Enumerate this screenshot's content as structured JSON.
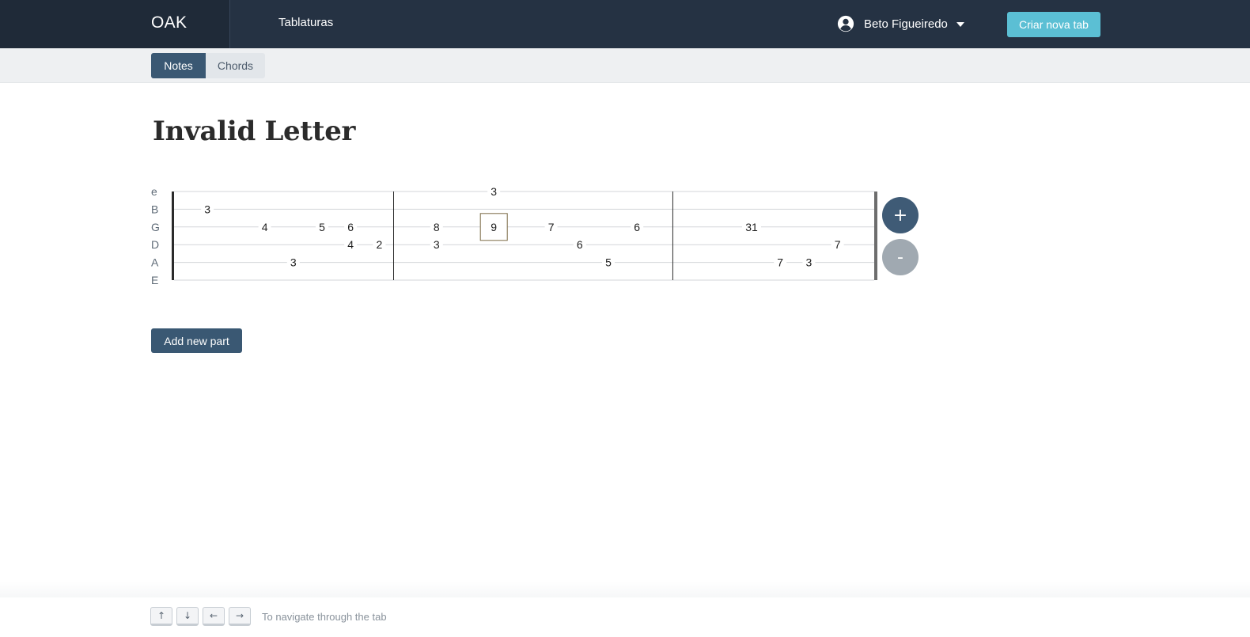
{
  "navbar": {
    "brand": "OAK",
    "nav_link": "Tablaturas",
    "user_name": "Beto Figueiredo",
    "cta_label": "Criar nova tab",
    "user_icon": "user-circle-icon",
    "caret_icon": "caret-down-icon"
  },
  "tabs": [
    {
      "label": "Notes",
      "active": true
    },
    {
      "label": "Chords",
      "active": false
    }
  ],
  "title": "Invalid Letter",
  "tablature": {
    "strings": [
      "e",
      "B",
      "G",
      "D",
      "A",
      "E"
    ],
    "notes": [
      {
        "string": 1,
        "col": 1,
        "fret": "3"
      },
      {
        "string": 2,
        "col": 3,
        "fret": "4"
      },
      {
        "string": 4,
        "col": 4,
        "fret": "3"
      },
      {
        "string": 2,
        "col": 5,
        "fret": "5"
      },
      {
        "string": 2,
        "col": 6,
        "fret": "6"
      },
      {
        "string": 3,
        "col": 6,
        "fret": "4"
      },
      {
        "string": 3,
        "col": 7,
        "fret": "2"
      },
      {
        "string": 2,
        "col": 9,
        "fret": "8"
      },
      {
        "string": 3,
        "col": 9,
        "fret": "3"
      },
      {
        "string": 0,
        "col": 11,
        "fret": "3"
      },
      {
        "string": 2,
        "col": 11,
        "fret": "9",
        "selected": true
      },
      {
        "string": 2,
        "col": 13,
        "fret": "7"
      },
      {
        "string": 3,
        "col": 14,
        "fret": "6"
      },
      {
        "string": 4,
        "col": 15,
        "fret": "5"
      },
      {
        "string": 2,
        "col": 16,
        "fret": "6"
      },
      {
        "string": 2,
        "col": 20,
        "fret": "31"
      },
      {
        "string": 4,
        "col": 21,
        "fret": "7"
      },
      {
        "string": 4,
        "col": 22,
        "fret": "3"
      },
      {
        "string": 3,
        "col": 23,
        "fret": "7"
      }
    ],
    "measure_bars_after_col": [
      7.5,
      17.25
    ]
  },
  "zoom": {
    "in_label": "+",
    "out_label": "-"
  },
  "add_part_label": "Add new part",
  "footer": {
    "keys": [
      {
        "name": "up",
        "glyph": "↑"
      },
      {
        "name": "down",
        "glyph": "↓"
      },
      {
        "name": "left",
        "glyph": "←"
      },
      {
        "name": "right",
        "glyph": "→"
      }
    ],
    "hint": "To navigate through the tab"
  }
}
